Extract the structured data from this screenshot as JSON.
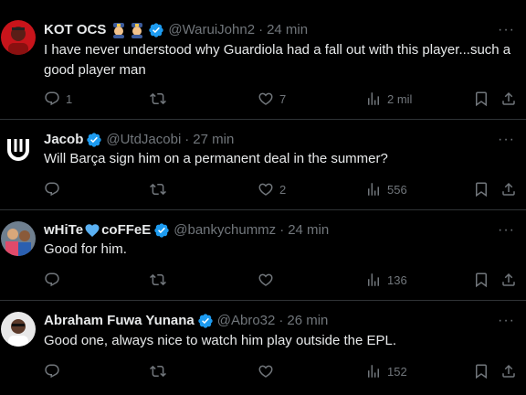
{
  "colors": {
    "background": "#000000",
    "text": "#e7e9ea",
    "muted": "#71767b",
    "verified": "#1d9bf0",
    "divider": "#2f3336"
  },
  "tweets": [
    {
      "name": "KOT OCS",
      "name_suffix_icons": [
        "police-officer-emoji",
        "police-officer-emoji"
      ],
      "handle": "@WaruiJohn2",
      "time": "24 min",
      "text": "I have never understood why Guardiola had a fall out with this player...such a good player man",
      "replies": "1",
      "retweets": "",
      "likes": "7",
      "views": "2 mil"
    },
    {
      "name": "Jacob",
      "handle": "@UtdJacobi",
      "time": "27 min",
      "text": "Will Barça sign him on a permanent deal in the summer?",
      "replies": "",
      "retweets": "",
      "likes": "2",
      "views": "556"
    },
    {
      "name": "wHiTe",
      "name_mid_icon": "blue-heart-emoji",
      "name_tail": "coFFeE",
      "handle": "@bankychummz",
      "time": "24 min",
      "text": "Good for him.",
      "replies": "",
      "retweets": "",
      "likes": "",
      "views": "136"
    },
    {
      "name": "Abraham Fuwa Yunana",
      "handle": "@Abro32",
      "time": "26 min",
      "text": "Good one, always nice to watch him play outside the EPL.",
      "replies": "",
      "retweets": "",
      "likes": "",
      "views": "152"
    }
  ]
}
